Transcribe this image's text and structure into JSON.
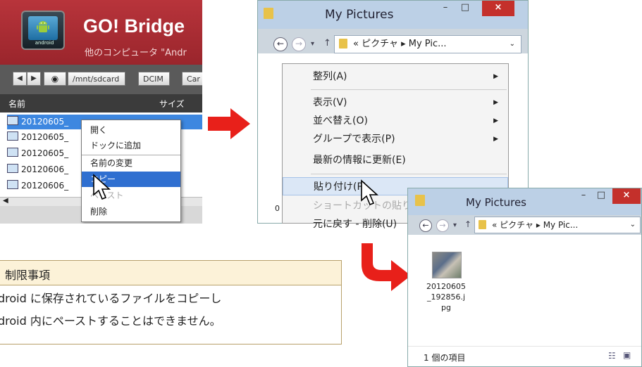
{
  "gobridge": {
    "title": "GO! Bridge",
    "subtitle": "他のコンピュータ \"Andr",
    "logo_text": "android",
    "path": {
      "nav_back": "◀",
      "nav_forward": "▶",
      "crumbs": [
        "/mnt/sdcard",
        "DCIM",
        "Car"
      ]
    },
    "columns": {
      "name": "名前",
      "size": "サイズ"
    },
    "files": [
      "20120605_",
      "20120605_",
      "20120605_",
      "20120606_",
      "20120606_"
    ],
    "menu": [
      "開く",
      "ドックに追加",
      "名前の変更",
      "コピー",
      "ペースト",
      "削除"
    ]
  },
  "explorer1": {
    "title": "My Pictures",
    "address": "« ピクチャ ▸ My Pic...",
    "menu": {
      "sort": "整列(A)",
      "view": "表示(V)",
      "sortby": "並べ替え(O)",
      "group": "グループで表示(P)",
      "refresh": "最新の情報に更新(E)",
      "paste": "貼り付け(P)",
      "paste_shortcut": "ショートカットの貼り付け",
      "undo": "元に戻す - 削除(U)"
    },
    "status_fragment": "0"
  },
  "explorer2": {
    "title": "My Pictures",
    "address": "« ピクチャ ▸ My Pic...",
    "file_name": [
      "20120605",
      "_192856.j",
      "pg"
    ],
    "status": "1 個の項目"
  },
  "window_buttons": {
    "minimize": "–",
    "maximize": "□",
    "close": "×"
  },
  "note": {
    "title": "制限事項",
    "line1": "droid に保存されているファイルをコピーし",
    "line2": "droid 内にペーストすることはできません。"
  },
  "colors": {
    "gobridge_header": "#a72c33",
    "selection": "#3d87e0",
    "arrow": "#e8201a",
    "close_button": "#c4302b"
  }
}
